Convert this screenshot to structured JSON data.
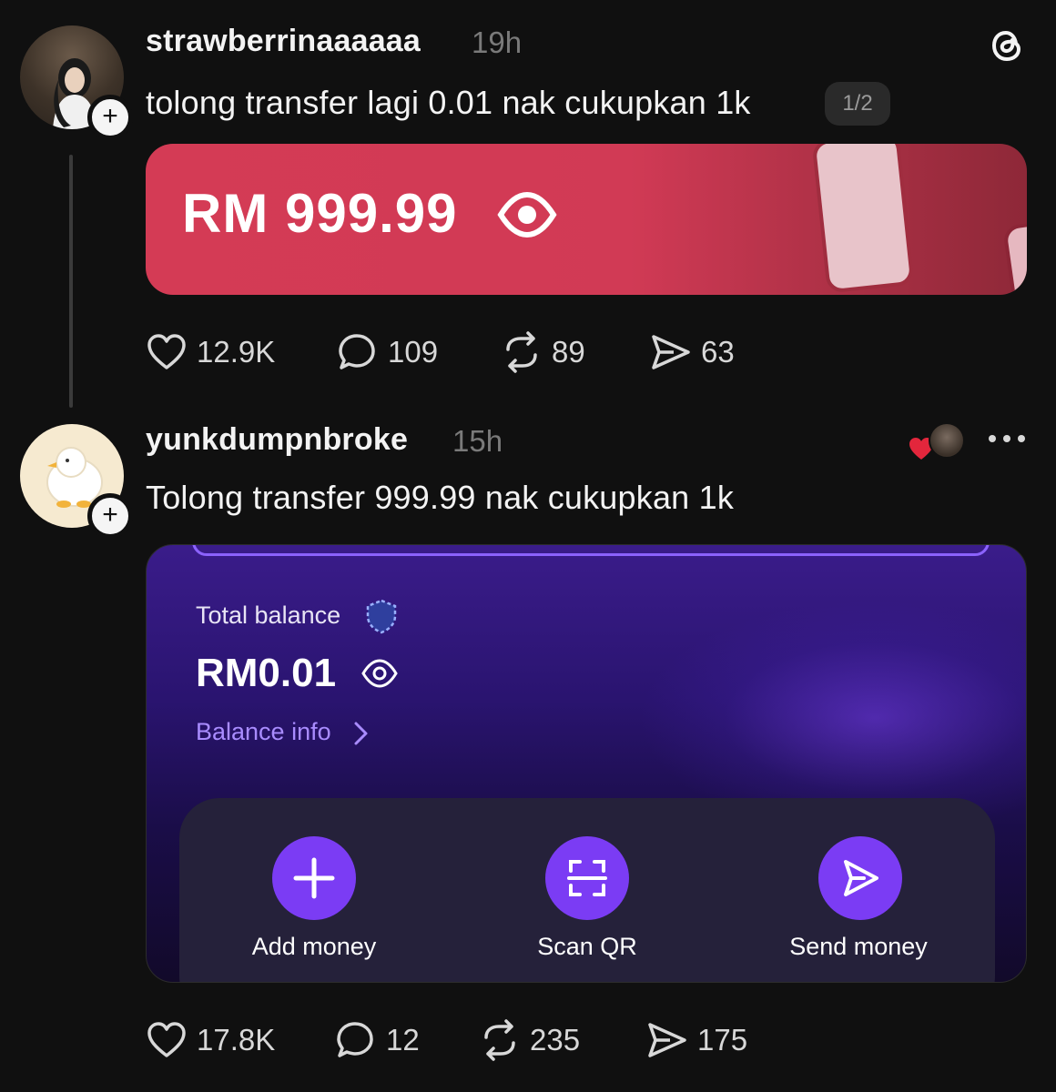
{
  "post1": {
    "username": "strawberrinaaaaaa",
    "time": "19h",
    "text": "tolong transfer lagi 0.01 nak cukupkan 1k",
    "page_indicator": "1/2",
    "image": {
      "amount": "RM 999.99"
    },
    "likes": "12.9K",
    "comments": "109",
    "reposts": "89",
    "shares": "63"
  },
  "post2": {
    "username": "yunkdumpnbroke",
    "time": "15h",
    "text": "Tolong transfer 999.99 nak cukupkan 1k",
    "image": {
      "balance_label": "Total balance",
      "balance_value": "RM0.01",
      "balance_info": "Balance info",
      "buttons": [
        {
          "label": "Add money",
          "icon": "plus-icon"
        },
        {
          "label": "Scan QR",
          "icon": "scan-qr-icon"
        },
        {
          "label": "Send money",
          "icon": "send-icon"
        }
      ]
    },
    "likes": "17.8K",
    "comments": "12",
    "reposts": "235",
    "shares": "175"
  },
  "colors": {
    "background": "#101010",
    "card_red": "#d43b55",
    "card_purple": "#2a1470",
    "accent_purple": "#7b3cf4",
    "balance_info": "#a98cff",
    "like_red": "#e3263c"
  }
}
